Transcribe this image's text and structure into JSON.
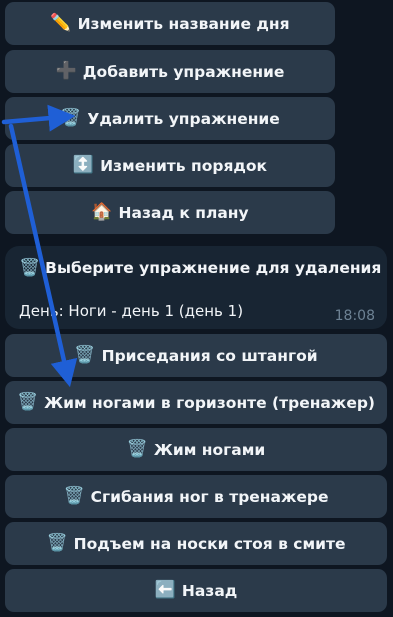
{
  "top_keyboard": {
    "buttons": [
      {
        "icon": "✏️",
        "icon_name": "pencil-icon",
        "label": "Изменить название дня"
      },
      {
        "icon": "➕",
        "icon_name": "plus-icon",
        "label": "Добавить упражнение"
      },
      {
        "icon": "🗑️",
        "icon_name": "trash-icon",
        "label": "Удалить упражнение"
      },
      {
        "icon": "↕️",
        "icon_name": "up-down-arrow-icon",
        "label": "Изменить порядок"
      },
      {
        "icon": "🏠",
        "icon_name": "house-icon",
        "label": "Назад к плану"
      }
    ]
  },
  "message": {
    "icon": "🗑️",
    "icon_name": "trash-icon",
    "title": "Выберите упражнение для удаления",
    "body": "День: Ноги - день 1 (день 1)",
    "time": "18:08"
  },
  "inline_keyboard": {
    "buttons": [
      {
        "icon": "🗑️",
        "icon_name": "trash-icon",
        "label": "Приседания со штангой"
      },
      {
        "icon": "🗑️",
        "icon_name": "trash-icon",
        "label": "Жим ногами в горизонте (тренажер)"
      },
      {
        "icon": "🗑️",
        "icon_name": "trash-icon",
        "label": "Жим ногами"
      },
      {
        "icon": "🗑️",
        "icon_name": "trash-icon",
        "label": "Сгибания ног в тренажере"
      },
      {
        "icon": "🗑️",
        "icon_name": "trash-icon",
        "label": "Подъем на носки стоя в смите"
      },
      {
        "icon": "⬅️",
        "icon_name": "left-arrow-icon",
        "label": "Назад"
      }
    ]
  },
  "colors": {
    "background": "#0e1621",
    "button": "#2b3a4a",
    "bubble": "#182533",
    "annotation_arrow": "#1f5fd6"
  }
}
